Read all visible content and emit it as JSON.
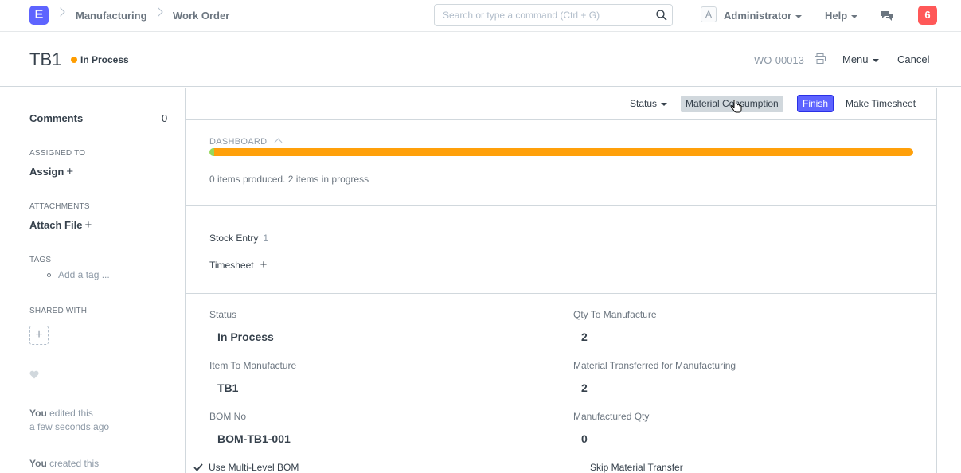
{
  "navbar": {
    "logo_letter": "E",
    "breadcrumbs": [
      "Manufacturing",
      "Work Order"
    ],
    "search_placeholder": "Search or type a command (Ctrl + G)",
    "avatar_letter": "A",
    "user": "Administrator",
    "help": "Help",
    "notification_count": "6"
  },
  "page_head": {
    "title": "TB1",
    "status": "In Process",
    "status_color": "#ff9d00",
    "doc_name": "WO-00013",
    "menu": "Menu",
    "cancel": "Cancel"
  },
  "sidebar": {
    "comments_label": "Comments",
    "comments_count": "0",
    "assigned_to_label": "ASSIGNED TO",
    "assign_action": "Assign",
    "attachments_label": "ATTACHMENTS",
    "attach_action": "Attach File",
    "tags_label": "TAGS",
    "tag_placeholder": "Add a tag ...",
    "shared_with_label": "SHARED WITH",
    "activity": [
      {
        "actor": "You",
        "action": "edited this",
        "time": "a few seconds ago"
      },
      {
        "actor": "You",
        "action": "created this"
      }
    ]
  },
  "toolbar": {
    "status": "Status",
    "material_consumption": "Material Consumption",
    "finish": "Finish",
    "make_timesheet": "Make Timesheet",
    "accent": "#5e64ff"
  },
  "dashboard": {
    "heading": "DASHBOARD",
    "produced_fraction": 0.0,
    "in_progress_fraction": 1.0,
    "summary": "0 items produced. 2 items in progress"
  },
  "links": [
    {
      "label": "Stock Entry",
      "count": "1"
    },
    {
      "label": "Timesheet",
      "count": ""
    }
  ],
  "fields": {
    "status_label": "Status",
    "status_value": "In Process",
    "item_label": "Item To Manufacture",
    "item_value": "TB1",
    "bom_label": "BOM No",
    "bom_value": "BOM-TB1-001",
    "multi_level_bom": "Use Multi-Level BOM",
    "qty_label": "Qty To Manufacture",
    "qty_value": "2",
    "transferred_label": "Material Transferred for Manufacturing",
    "transferred_value": "2",
    "manufactured_label": "Manufactured Qty",
    "manufactured_value": "0",
    "skip_transfer": "Skip Material Transfer"
  }
}
